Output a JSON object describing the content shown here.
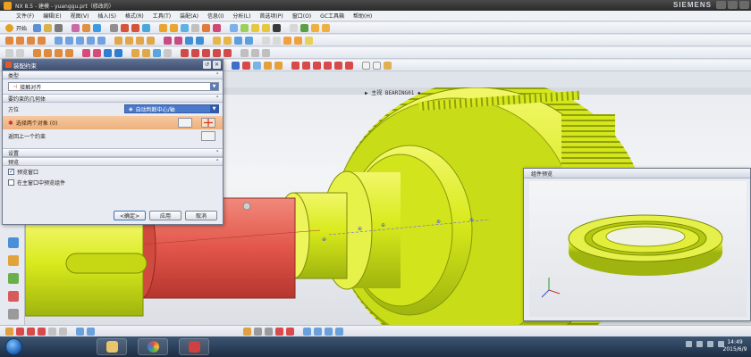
{
  "app": {
    "title": "NX 8.5 - 建模 - yuanggu.prt（修改的）",
    "brand": "SIEMENS"
  },
  "menu": [
    "文件(F)",
    "编辑(E)",
    "视图(V)",
    "插入(S)",
    "格式(R)",
    "工具(T)",
    "装配(A)",
    "信息(I)",
    "分析(L)",
    "首选项(P)",
    "窗口(O)",
    "GC工具箱",
    "帮助(H)"
  ],
  "toolbar": {
    "start_label": "开始"
  },
  "viewport": {
    "title": "▶ 主视 BEARING01 ◆"
  },
  "dialog": {
    "title": "装配约束",
    "group_type": "类型",
    "type_value": "接触对齐",
    "group_geometry": "要约束的几何体",
    "orientation_label": "方位",
    "orientation_value": "自动判断中心/轴",
    "select_objects": "选择两个对象 (0)",
    "return_label": "返回上一个约束",
    "group_settings": "设置",
    "group_preview": "预览",
    "preview_window": "预览窗口",
    "show_in_main": "在主窗口中预览组件",
    "ok": "<确定>",
    "apply": "应用",
    "cancel": "取消"
  },
  "preview": {
    "title": "组件预览"
  },
  "taskbar": {
    "time": "14:49",
    "date": "2015/6/9"
  },
  "colors": {
    "gear_yellow": "#d8ea1c",
    "shaft_red": "#e2554a",
    "dialog_selection": "#f0b67f",
    "accent_blue": "#4b79c9"
  }
}
